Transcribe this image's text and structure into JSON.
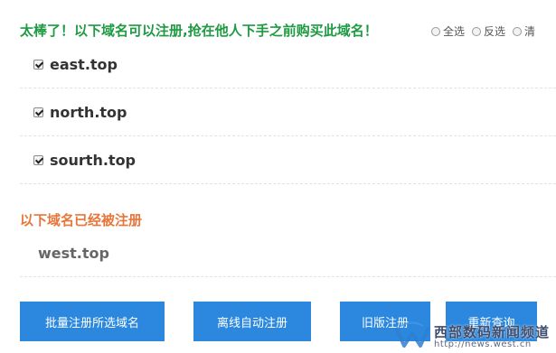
{
  "available": {
    "heading": "太棒了！以下域名可以注册,抢在他人下手之前购买此域名！",
    "select_options": [
      "全选",
      "反选",
      "清"
    ],
    "domains": [
      {
        "name": "east.top",
        "checked": true
      },
      {
        "name": "north.top",
        "checked": true
      },
      {
        "name": "sourth.top",
        "checked": true
      }
    ]
  },
  "taken": {
    "heading": "以下域名已经被注册",
    "domains": [
      {
        "name": "west.top"
      }
    ]
  },
  "actions": {
    "batch_register": "批量注册所选域名",
    "offline_auto_register": "离线自动注册",
    "old_register": "旧版注册",
    "requery": "重新查询"
  },
  "watermark": {
    "title": "西部数码新闻频道",
    "url": "http://news.west.cn"
  },
  "colors": {
    "available_heading": "#1e9a43",
    "taken_heading": "#e8763a",
    "button_bg": "#2b88de"
  }
}
